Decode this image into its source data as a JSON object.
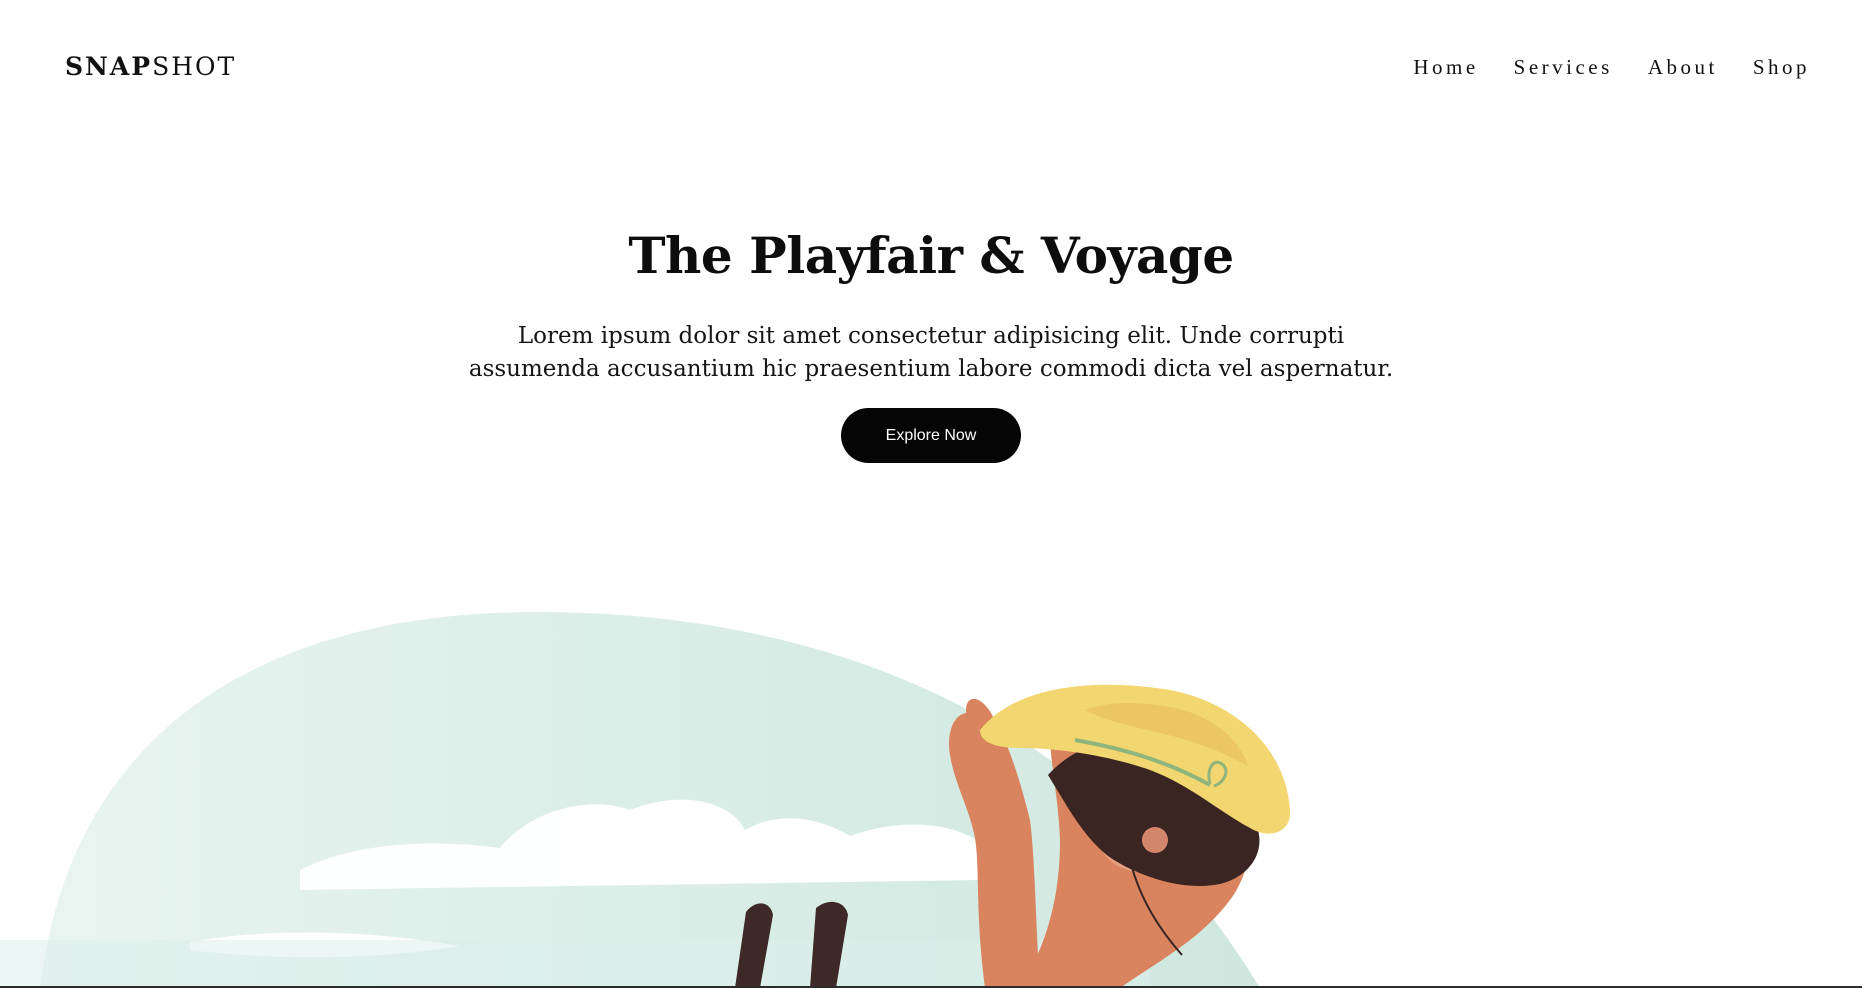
{
  "header": {
    "logo_bold": "SNAP",
    "logo_light": "SHOT",
    "nav": [
      {
        "label": "Home"
      },
      {
        "label": "Services"
      },
      {
        "label": "About"
      },
      {
        "label": "Shop"
      }
    ]
  },
  "hero": {
    "title": "The Playfair & Voyage",
    "description": "Lorem ipsum dolor sit amet consectetur adipisicing elit. Unde corrupti assumenda accusantium hic praesentium labore commodi dicta vel aspernatur.",
    "cta_label": "Explore Now"
  },
  "illustration": {
    "subject": "woman-with-sun-hat-icon",
    "colors": {
      "sky": "#dff1eb",
      "hat": "#f4d66d",
      "skin": "#d9835f",
      "hair": "#3a2523",
      "cloud": "#ffffff",
      "band": "#8fb57d"
    }
  }
}
